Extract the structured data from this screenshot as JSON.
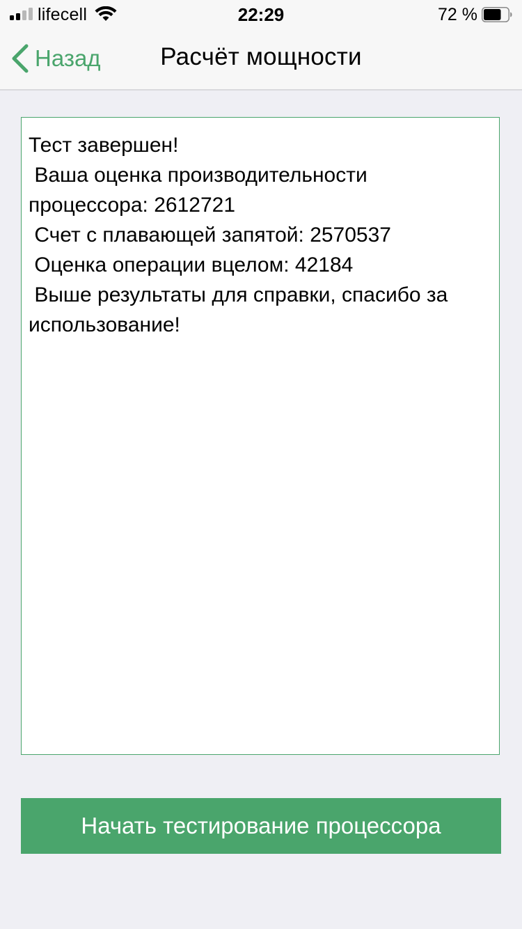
{
  "status_bar": {
    "carrier": "lifecell",
    "time": "22:29",
    "battery_percent": "72 %",
    "battery_level": 0.72,
    "signal_bars_filled": 2,
    "signal_bars_total": 4,
    "icons": [
      "signal-icon",
      "wifi-icon",
      "battery-icon"
    ]
  },
  "nav": {
    "back_label": "Назад",
    "title": "Расчёт мощности",
    "back_icon": "chevron-left-icon"
  },
  "result": {
    "text": "Тест завершен!\n Ваша оценка производительности процессора: 2612721\n Счет с плавающей запятой: 2570537\n Оценка операции вцелом: 42184\n Выше результаты для справки, спасибо за использование!"
  },
  "actions": {
    "start_label": "Начать тестирование процессора"
  },
  "colors": {
    "accent": "#4aa56c",
    "background": "#efeff4",
    "header_background": "#f7f7f7",
    "text": "#000000",
    "button_text": "#ffffff"
  }
}
